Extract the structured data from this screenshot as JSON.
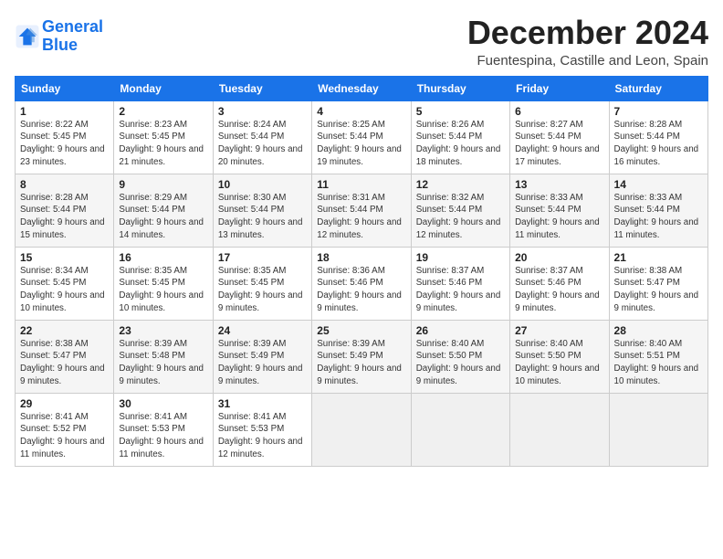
{
  "header": {
    "logo_line1": "General",
    "logo_line2": "Blue",
    "month_title": "December 2024",
    "location": "Fuentespina, Castille and Leon, Spain"
  },
  "weekdays": [
    "Sunday",
    "Monday",
    "Tuesday",
    "Wednesday",
    "Thursday",
    "Friday",
    "Saturday"
  ],
  "weeks": [
    [
      {
        "day": "1",
        "sunrise": "Sunrise: 8:22 AM",
        "sunset": "Sunset: 5:45 PM",
        "daylight": "Daylight: 9 hours and 23 minutes."
      },
      {
        "day": "2",
        "sunrise": "Sunrise: 8:23 AM",
        "sunset": "Sunset: 5:45 PM",
        "daylight": "Daylight: 9 hours and 21 minutes."
      },
      {
        "day": "3",
        "sunrise": "Sunrise: 8:24 AM",
        "sunset": "Sunset: 5:44 PM",
        "daylight": "Daylight: 9 hours and 20 minutes."
      },
      {
        "day": "4",
        "sunrise": "Sunrise: 8:25 AM",
        "sunset": "Sunset: 5:44 PM",
        "daylight": "Daylight: 9 hours and 19 minutes."
      },
      {
        "day": "5",
        "sunrise": "Sunrise: 8:26 AM",
        "sunset": "Sunset: 5:44 PM",
        "daylight": "Daylight: 9 hours and 18 minutes."
      },
      {
        "day": "6",
        "sunrise": "Sunrise: 8:27 AM",
        "sunset": "Sunset: 5:44 PM",
        "daylight": "Daylight: 9 hours and 17 minutes."
      },
      {
        "day": "7",
        "sunrise": "Sunrise: 8:28 AM",
        "sunset": "Sunset: 5:44 PM",
        "daylight": "Daylight: 9 hours and 16 minutes."
      }
    ],
    [
      {
        "day": "8",
        "sunrise": "Sunrise: 8:28 AM",
        "sunset": "Sunset: 5:44 PM",
        "daylight": "Daylight: 9 hours and 15 minutes."
      },
      {
        "day": "9",
        "sunrise": "Sunrise: 8:29 AM",
        "sunset": "Sunset: 5:44 PM",
        "daylight": "Daylight: 9 hours and 14 minutes."
      },
      {
        "day": "10",
        "sunrise": "Sunrise: 8:30 AM",
        "sunset": "Sunset: 5:44 PM",
        "daylight": "Daylight: 9 hours and 13 minutes."
      },
      {
        "day": "11",
        "sunrise": "Sunrise: 8:31 AM",
        "sunset": "Sunset: 5:44 PM",
        "daylight": "Daylight: 9 hours and 12 minutes."
      },
      {
        "day": "12",
        "sunrise": "Sunrise: 8:32 AM",
        "sunset": "Sunset: 5:44 PM",
        "daylight": "Daylight: 9 hours and 12 minutes."
      },
      {
        "day": "13",
        "sunrise": "Sunrise: 8:33 AM",
        "sunset": "Sunset: 5:44 PM",
        "daylight": "Daylight: 9 hours and 11 minutes."
      },
      {
        "day": "14",
        "sunrise": "Sunrise: 8:33 AM",
        "sunset": "Sunset: 5:44 PM",
        "daylight": "Daylight: 9 hours and 11 minutes."
      }
    ],
    [
      {
        "day": "15",
        "sunrise": "Sunrise: 8:34 AM",
        "sunset": "Sunset: 5:45 PM",
        "daylight": "Daylight: 9 hours and 10 minutes."
      },
      {
        "day": "16",
        "sunrise": "Sunrise: 8:35 AM",
        "sunset": "Sunset: 5:45 PM",
        "daylight": "Daylight: 9 hours and 10 minutes."
      },
      {
        "day": "17",
        "sunrise": "Sunrise: 8:35 AM",
        "sunset": "Sunset: 5:45 PM",
        "daylight": "Daylight: 9 hours and 9 minutes."
      },
      {
        "day": "18",
        "sunrise": "Sunrise: 8:36 AM",
        "sunset": "Sunset: 5:46 PM",
        "daylight": "Daylight: 9 hours and 9 minutes."
      },
      {
        "day": "19",
        "sunrise": "Sunrise: 8:37 AM",
        "sunset": "Sunset: 5:46 PM",
        "daylight": "Daylight: 9 hours and 9 minutes."
      },
      {
        "day": "20",
        "sunrise": "Sunrise: 8:37 AM",
        "sunset": "Sunset: 5:46 PM",
        "daylight": "Daylight: 9 hours and 9 minutes."
      },
      {
        "day": "21",
        "sunrise": "Sunrise: 8:38 AM",
        "sunset": "Sunset: 5:47 PM",
        "daylight": "Daylight: 9 hours and 9 minutes."
      }
    ],
    [
      {
        "day": "22",
        "sunrise": "Sunrise: 8:38 AM",
        "sunset": "Sunset: 5:47 PM",
        "daylight": "Daylight: 9 hours and 9 minutes."
      },
      {
        "day": "23",
        "sunrise": "Sunrise: 8:39 AM",
        "sunset": "Sunset: 5:48 PM",
        "daylight": "Daylight: 9 hours and 9 minutes."
      },
      {
        "day": "24",
        "sunrise": "Sunrise: 8:39 AM",
        "sunset": "Sunset: 5:49 PM",
        "daylight": "Daylight: 9 hours and 9 minutes."
      },
      {
        "day": "25",
        "sunrise": "Sunrise: 8:39 AM",
        "sunset": "Sunset: 5:49 PM",
        "daylight": "Daylight: 9 hours and 9 minutes."
      },
      {
        "day": "26",
        "sunrise": "Sunrise: 8:40 AM",
        "sunset": "Sunset: 5:50 PM",
        "daylight": "Daylight: 9 hours and 9 minutes."
      },
      {
        "day": "27",
        "sunrise": "Sunrise: 8:40 AM",
        "sunset": "Sunset: 5:50 PM",
        "daylight": "Daylight: 9 hours and 10 minutes."
      },
      {
        "day": "28",
        "sunrise": "Sunrise: 8:40 AM",
        "sunset": "Sunset: 5:51 PM",
        "daylight": "Daylight: 9 hours and 10 minutes."
      }
    ],
    [
      {
        "day": "29",
        "sunrise": "Sunrise: 8:41 AM",
        "sunset": "Sunset: 5:52 PM",
        "daylight": "Daylight: 9 hours and 11 minutes."
      },
      {
        "day": "30",
        "sunrise": "Sunrise: 8:41 AM",
        "sunset": "Sunset: 5:53 PM",
        "daylight": "Daylight: 9 hours and 11 minutes."
      },
      {
        "day": "31",
        "sunrise": "Sunrise: 8:41 AM",
        "sunset": "Sunset: 5:53 PM",
        "daylight": "Daylight: 9 hours and 12 minutes."
      },
      null,
      null,
      null,
      null
    ]
  ]
}
